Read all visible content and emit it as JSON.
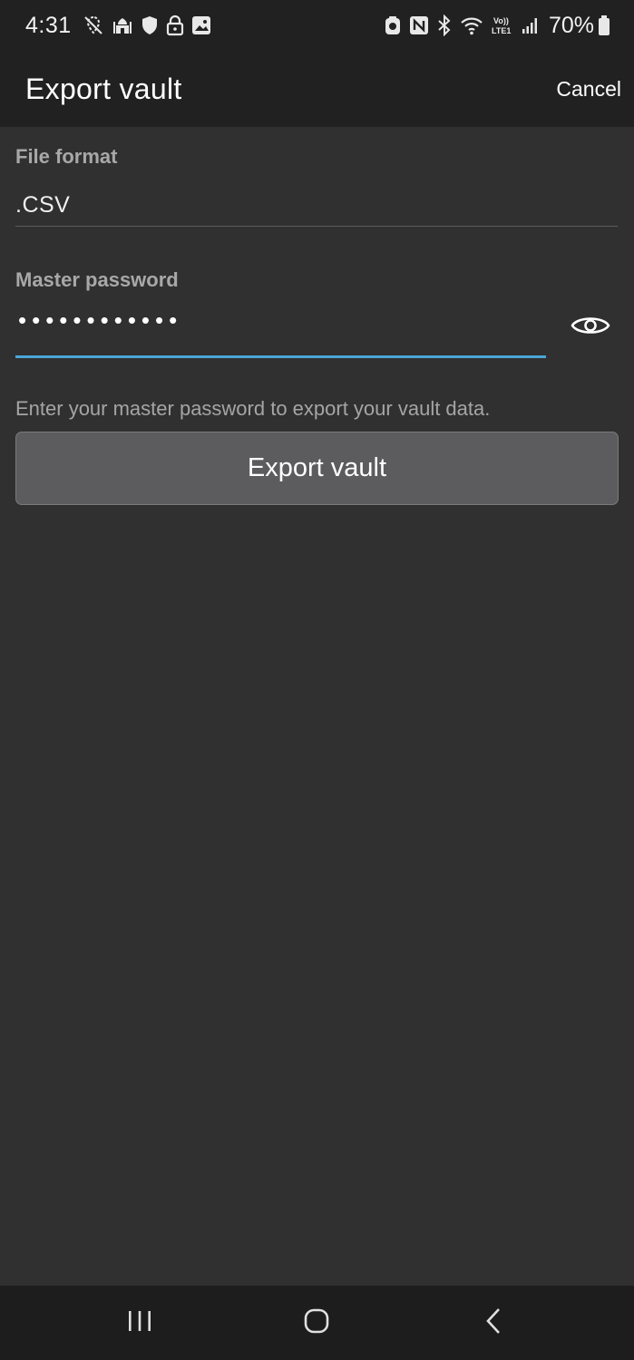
{
  "status_bar": {
    "time": "4:31",
    "battery_percent": "70%",
    "left_icons": [
      "location-off-icon",
      "mosque-icon",
      "shield-icon",
      "lock-icon",
      "image-icon"
    ],
    "right_icons": [
      "app-notification-icon",
      "nfc-icon",
      "bluetooth-icon",
      "wifi-icon",
      "volte-icon",
      "signal-icon",
      "battery-icon"
    ],
    "volte_label": "Vo)) LTE1"
  },
  "header": {
    "title": "Export vault",
    "cancel_label": "Cancel"
  },
  "form": {
    "file_format_label": "File format",
    "file_format_value": ".CSV",
    "master_password_label": "Master password",
    "master_password_value": "••••••••••••",
    "helper_text": "Enter your master password to export your vault data.",
    "export_button_label": "Export vault",
    "accent_color": "#4aa6d8"
  },
  "nav_bar": {
    "buttons": [
      "recents-icon",
      "home-icon",
      "back-icon"
    ]
  }
}
